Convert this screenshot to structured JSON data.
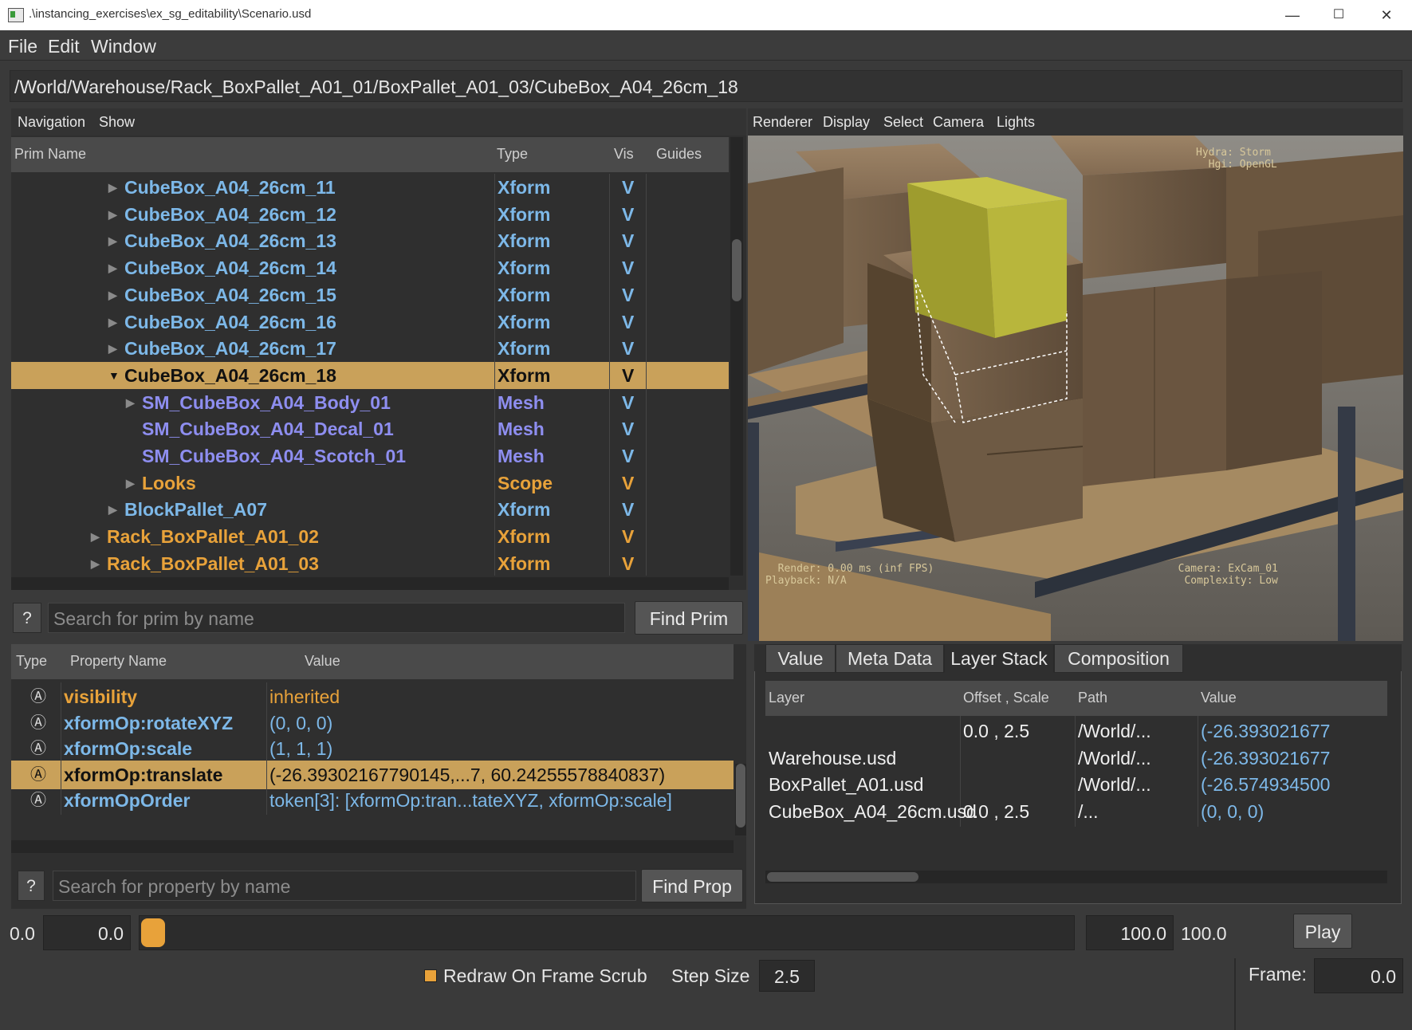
{
  "window": {
    "title": ".\\instancing_exercises\\ex_sg_editability\\Scenario.usd",
    "minimize": "—",
    "maximize": "☐",
    "close": "✕"
  },
  "menu": [
    "File",
    "Edit",
    "Window"
  ],
  "path": "/World/Warehouse/Rack_BoxPallet_A01_01/BoxPallet_A01_03/CubeBox_A04_26cm_18",
  "tree": {
    "toolbar": [
      "Navigation",
      "Show"
    ],
    "columns": [
      "Prim Name",
      "Type",
      "Vis",
      "Guides"
    ],
    "rows": [
      {
        "name": "CubeBox_A04_26cm_11",
        "type": "Xform",
        "vis": "V"
      },
      {
        "name": "CubeBox_A04_26cm_12",
        "type": "Xform",
        "vis": "V"
      },
      {
        "name": "CubeBox_A04_26cm_13",
        "type": "Xform",
        "vis": "V"
      },
      {
        "name": "CubeBox_A04_26cm_14",
        "type": "Xform",
        "vis": "V"
      },
      {
        "name": "CubeBox_A04_26cm_15",
        "type": "Xform",
        "vis": "V"
      },
      {
        "name": "CubeBox_A04_26cm_16",
        "type": "Xform",
        "vis": "V"
      },
      {
        "name": "CubeBox_A04_26cm_17",
        "type": "Xform",
        "vis": "V"
      },
      {
        "name": "CubeBox_A04_26cm_18",
        "type": "Xform",
        "vis": "V"
      },
      {
        "name": "SM_CubeBox_A04_Body_01",
        "type": "Mesh",
        "vis": "V"
      },
      {
        "name": "SM_CubeBox_A04_Decal_01",
        "type": "Mesh",
        "vis": "V"
      },
      {
        "name": "SM_CubeBox_A04_Scotch_01",
        "type": "Mesh",
        "vis": "V"
      },
      {
        "name": "Looks",
        "type": "Scope",
        "vis": "V"
      },
      {
        "name": "BlockPallet_A07",
        "type": "Xform",
        "vis": "V"
      },
      {
        "name": "Rack_BoxPallet_A01_02",
        "type": "Xform",
        "vis": "V"
      },
      {
        "name": "Rack_BoxPallet_A01_03",
        "type": "Xform",
        "vis": "V"
      }
    ],
    "help_label": "?",
    "search_placeholder": "Search for prim by name",
    "find_label": "Find Prim"
  },
  "viewport": {
    "toolbar": [
      "Renderer",
      "Display",
      "Select",
      "Camera",
      "Lights"
    ],
    "hud_top_right": "Hydra: Storm\n  Hgi: OpenGL",
    "hud_bottom_left": "  Render: 0.00 ms (inf FPS)\nPlayback: N/A",
    "hud_bottom_right": "  Camera: ExCam_01\nComplexity: Low"
  },
  "properties": {
    "columns": [
      "Type",
      "Property Name",
      "Value"
    ],
    "rows": [
      {
        "icon": "Ⓐ",
        "name": "visibility",
        "value": "inherited"
      },
      {
        "icon": "Ⓐ",
        "name": "xformOp:rotateXYZ",
        "value": "(0, 0, 0)"
      },
      {
        "icon": "Ⓐ",
        "name": "xformOp:scale",
        "value": "(1, 1, 1)"
      },
      {
        "icon": "Ⓐ",
        "name": "xformOp:translate",
        "value": "(-26.39302167790145,...7, 60.24255578840837)"
      },
      {
        "icon": "Ⓐ",
        "name": "xformOpOrder",
        "value": "token[3]: [xformOp:tran...tateXYZ, xformOp:scale]"
      }
    ],
    "help_label": "?",
    "search_placeholder": "Search for property by name",
    "find_label": "Find Prop"
  },
  "layer_stack": {
    "tabs": [
      "Value",
      "Meta Data",
      "Layer Stack",
      "Composition"
    ],
    "active_tab": "Layer Stack",
    "columns": [
      "Layer",
      "Offset , Scale",
      "Path",
      "Value"
    ],
    "rows": [
      {
        "layer": "",
        "offset": "0.0 , 2.5",
        "path": "/World/...",
        "value": "(-26.393021677"
      },
      {
        "layer": "Warehouse.usd",
        "offset": "",
        "path": "/World/...",
        "value": "(-26.393021677"
      },
      {
        "layer": "BoxPallet_A01.usd",
        "offset": "",
        "path": "/World/...",
        "value": "(-26.574934500"
      },
      {
        "layer": "CubeBox_A04_26cm.usd",
        "offset": "0.0 , 2.5",
        "path": "/...",
        "value": "(0, 0, 0)"
      }
    ]
  },
  "playback": {
    "range_start": "0.0",
    "start_field": "0.0",
    "end_field": "100.0",
    "range_end": "100.0",
    "play_label": "Play",
    "redraw_label": "Redraw On Frame Scrub",
    "redraw_checked": true,
    "step_label": "Step Size",
    "step_value": "2.5",
    "frame_label": "Frame:",
    "frame_value": "0.0",
    "scrub_position": 0
  },
  "colors": {
    "selection": "#c9a15a",
    "xform_text": "#7db8e8",
    "mesh_text": "#8e8ef0",
    "scope_text": "#e8a23a",
    "highlight_box": "#b9b93a"
  }
}
